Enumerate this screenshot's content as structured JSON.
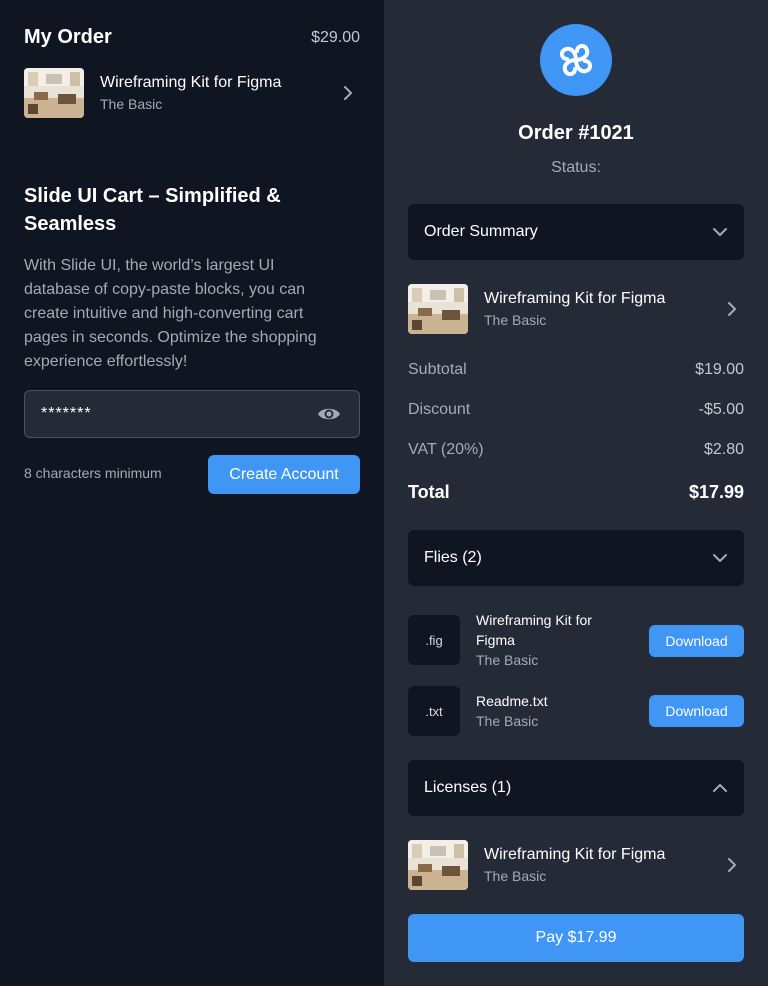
{
  "order": {
    "title": "My Order",
    "price": "$29.00",
    "item": {
      "name": "Wireframing Kit for Figma",
      "variant": "The Basic"
    }
  },
  "promo": {
    "heading": "Slide UI Cart – Simplified & Seamless",
    "description": "With Slide UI, the world’s largest UI database of copy-paste blocks, you can create intuitive and high-converting cart pages in seconds. Optimize the shopping experience effortlessly!"
  },
  "password": {
    "value": "*******",
    "hint": "8 characters minimum"
  },
  "create_account_label": "Create Account",
  "summary_panel": {
    "order_number": "Order #1021",
    "status_label": "Status:",
    "order_summary_label": "Order Summary",
    "item": {
      "name": "Wireframing Kit for Figma",
      "variant": "The Basic"
    },
    "rows": [
      {
        "label": "Subtotal",
        "value": "$19.00"
      },
      {
        "label": "Discount",
        "value": "-$5.00"
      },
      {
        "label": "VAT (20%)",
        "value": "$2.80"
      }
    ],
    "total": {
      "label": "Total",
      "value": "$17.99"
    },
    "files_label": "Flies (2)",
    "files": [
      {
        "ext": ".fig",
        "name": "Wireframing Kit for Figma",
        "variant": "The Basic",
        "action": "Download"
      },
      {
        "ext": ".txt",
        "name": "Readme.txt",
        "variant": "The Basic",
        "action": "Download"
      }
    ],
    "licenses_label": "Licenses (1)",
    "license_item": {
      "name": "Wireframing Kit for Figma",
      "variant": "The Basic"
    },
    "pay_label": "Pay $17.99"
  },
  "colors": {
    "accent": "#3f96f5",
    "left_bg": "#0f1521",
    "right_bg": "#252b36",
    "muted_text": "#a4abb6"
  },
  "icons": [
    "chevron-right-icon",
    "eye-icon",
    "brand-logo-icon",
    "chevron-down-icon",
    "chevron-up-icon"
  ]
}
